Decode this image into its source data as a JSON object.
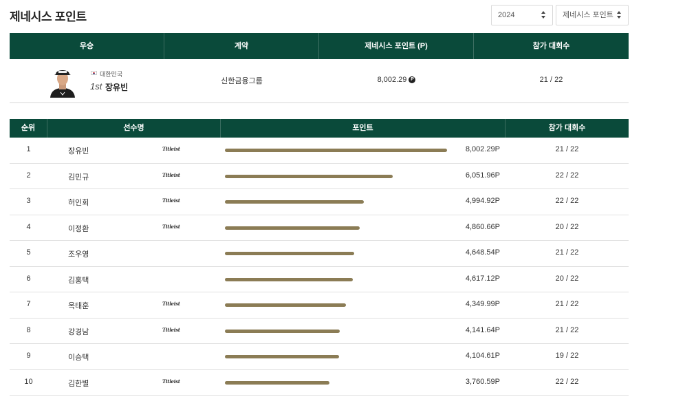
{
  "page": {
    "title": "제네시스 포인트"
  },
  "filters": {
    "year": "2024",
    "type": "제네시스 포인트"
  },
  "winner_table": {
    "headers": [
      "우승",
      "계약",
      "제네시스 포인트 (P)",
      "참가 대회수"
    ],
    "winner": {
      "country": "대한민국",
      "rank": "1st",
      "name": "장유빈",
      "sponsor": "신한금융그룹",
      "points": "8,002.29",
      "points_badge": "P",
      "events": "21 / 22"
    }
  },
  "ranking_table": {
    "headers": [
      "순위",
      "선수명",
      "포인트",
      "참가 대회수"
    ],
    "max_points": 8002.29,
    "rows": [
      {
        "rank": "1",
        "name": "장유빈",
        "brand": "Titleist",
        "points_value": 8002.29,
        "points": "8,002.29P",
        "events": "21 / 22"
      },
      {
        "rank": "2",
        "name": "김민규",
        "brand": "Titleist",
        "points_value": 6051.96,
        "points": "6,051.96P",
        "events": "22 / 22"
      },
      {
        "rank": "3",
        "name": "허인회",
        "brand": "Titleist",
        "points_value": 4994.92,
        "points": "4,994.92P",
        "events": "22 / 22"
      },
      {
        "rank": "4",
        "name": "이정환",
        "brand": "Titleist",
        "points_value": 4860.66,
        "points": "4,860.66P",
        "events": "20 / 22"
      },
      {
        "rank": "5",
        "name": "조우영",
        "brand": "",
        "points_value": 4648.54,
        "points": "4,648.54P",
        "events": "21 / 22"
      },
      {
        "rank": "6",
        "name": "김홍택",
        "brand": "",
        "points_value": 4617.12,
        "points": "4,617.12P",
        "events": "20 / 22"
      },
      {
        "rank": "7",
        "name": "옥태훈",
        "brand": "Titleist",
        "points_value": 4349.99,
        "points": "4,349.99P",
        "events": "21 / 22"
      },
      {
        "rank": "8",
        "name": "강경남",
        "brand": "Titleist",
        "points_value": 4141.64,
        "points": "4,141.64P",
        "events": "21 / 22"
      },
      {
        "rank": "9",
        "name": "이승택",
        "brand": "",
        "points_value": 4104.61,
        "points": "4,104.61P",
        "events": "19 / 22"
      },
      {
        "rank": "10",
        "name": "김한별",
        "brand": "Titleist",
        "points_value": 3760.59,
        "points": "3,760.59P",
        "events": "22 / 22"
      }
    ]
  },
  "colors": {
    "header_bg": "#0a4a3a",
    "bar": "#8b7c55"
  }
}
